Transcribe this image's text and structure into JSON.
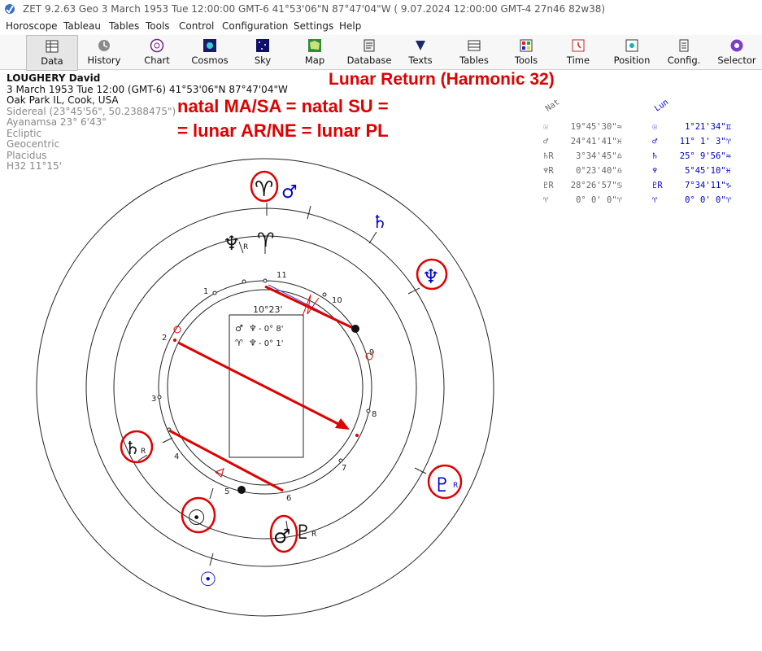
{
  "titlebar": {
    "text": "ZET 9.2.63 Geo    3 March 1953  Tue  12:00:00 GMT-6 41°53'06\"N  87°47'04\"W  ( 9.07.2024  12:00:00 GMT-4 27n46 82w38)"
  },
  "menu": [
    "Horoscope",
    "Tableau",
    "Tables",
    "Tools",
    "Control",
    "Configuration",
    "Settings",
    "Help"
  ],
  "toolbar": [
    {
      "label": "Data",
      "icon": "data-icon"
    },
    {
      "label": "History",
      "icon": "history-icon"
    },
    {
      "label": "Chart",
      "icon": "chart-icon"
    },
    {
      "label": "Cosmos",
      "icon": "cosmos-icon"
    },
    {
      "label": "Sky",
      "icon": "sky-icon"
    },
    {
      "label": "Map",
      "icon": "map-icon"
    },
    {
      "label": "Database",
      "icon": "database-icon"
    },
    {
      "label": "Texts",
      "icon": "texts-icon"
    },
    {
      "label": "Tables",
      "icon": "tables-icon"
    },
    {
      "label": "Tools",
      "icon": "tools-icon"
    },
    {
      "label": "Time",
      "icon": "time-icon"
    },
    {
      "label": "Position",
      "icon": "position-icon"
    },
    {
      "label": "Config.",
      "icon": "config-icon"
    },
    {
      "label": "Selector",
      "icon": "selector-icon"
    }
  ],
  "info": {
    "name": "LOUGHERY David",
    "datetime": "3 March 1953  Tue  12:00 (GMT-6) 41°53'06\"N  87°47'04\"W",
    "place": "Oak Park IL, Cook, USA",
    "sidereal": "Sidereal (23°45'56\", 50.2388475\")",
    "ayanamsa": "Ayanamsa 23° 6'43\"",
    "ecliptic": "Ecliptic",
    "geocentric": "Geocentric",
    "placidus": "Placidus",
    "harmonic": "H32  11°15'"
  },
  "annotations": {
    "title": "Lunar Return (Harmonic 32)",
    "line1": "natal MA/SA = natal SU =",
    "line2": "= lunar AR/NE = lunar PL"
  },
  "positions": {
    "nat_header": "Nat",
    "lun_header": "Lun",
    "nat": [
      {
        "sym": "☉",
        "val": "19°45'30\"",
        "sign": "≈"
      },
      {
        "sym": "♂",
        "val": "24°41'41\"",
        "sign": "♓"
      },
      {
        "sym": "♄R",
        "val": "3°34'45\"",
        "sign": "♎"
      },
      {
        "sym": "♆R",
        "val": "0°23'40\"",
        "sign": "♎"
      },
      {
        "sym": "♇R",
        "val": "28°26'57\"",
        "sign": "♋"
      },
      {
        "sym": "♈",
        "val": "0° 0' 0\"",
        "sign": "♈"
      }
    ],
    "lun": [
      {
        "sym": "☉",
        "val": "1°21'34\"",
        "sign": "♊"
      },
      {
        "sym": "♂",
        "val": "11° 1' 3\"",
        "sign": "♈"
      },
      {
        "sym": "♄",
        "val": "25° 9'56\"",
        "sign": "≈"
      },
      {
        "sym": "♆",
        "val": "5°45'10\"",
        "sign": "♓"
      },
      {
        "sym": "♇R",
        "val": "7°34'11\"",
        "sign": "♑"
      },
      {
        "sym": "♈",
        "val": "0° 0' 0\"",
        "sign": "♈"
      }
    ]
  },
  "wheel": {
    "center_degree": "10°23'",
    "aspects": [
      {
        "a": "♂",
        "b": "♆",
        "val": "- 0° 8'"
      },
      {
        "a": "♈",
        "b": "♆",
        "val": "- 0° 1'"
      }
    ],
    "houses": [
      "1",
      "2",
      "3",
      "4",
      "5",
      "6",
      "7",
      "8",
      "9",
      "10",
      "11"
    ],
    "glyphs_outer": {
      "aries": "♈",
      "mars": "♂",
      "saturn": "♄",
      "neptune": "♆",
      "pluto": "♇",
      "pluto_r": "R",
      "sun": "☉"
    },
    "glyphs_inner": {
      "neptune": "♆",
      "neptune_r": "R",
      "aries": "♈",
      "saturn": "♄",
      "saturn_r": "R",
      "sun": "☉",
      "mars": "♂",
      "pluto": "♇",
      "pluto_r": "R"
    }
  },
  "colors": {
    "annotation_red": "#e00000",
    "lunar_blue": "#0000d0",
    "natal_black": "#111111"
  }
}
